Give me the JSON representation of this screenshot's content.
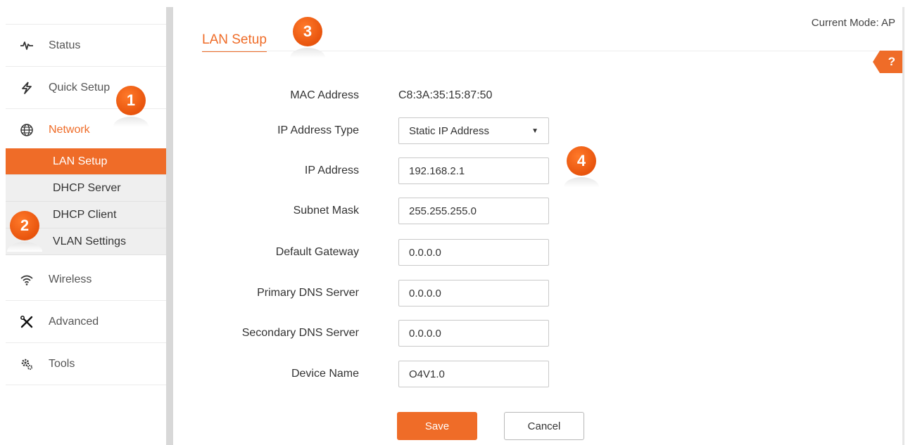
{
  "sidebar": {
    "items": [
      {
        "label": "Status",
        "icon": "pulse-icon"
      },
      {
        "label": "Quick Setup",
        "icon": "bolt-icon"
      },
      {
        "label": "Network",
        "icon": "globe-icon"
      },
      {
        "label": "Wireless",
        "icon": "wifi-icon"
      },
      {
        "label": "Advanced",
        "icon": "tools-cross-icon"
      },
      {
        "label": "Tools",
        "icon": "gears-icon"
      }
    ],
    "network_sub": [
      {
        "label": "LAN Setup"
      },
      {
        "label": "DHCP Server"
      },
      {
        "label": "DHCP Client"
      },
      {
        "label": "VLAN Settings"
      }
    ]
  },
  "header": {
    "mode": "Current Mode: AP",
    "title": "LAN Setup",
    "help": "?"
  },
  "form": {
    "mac": {
      "label": "MAC Address",
      "value": "C8:3A:35:15:87:50"
    },
    "ip_type": {
      "label": "IP Address Type",
      "value": "Static IP Address"
    },
    "ip": {
      "label": "IP Address",
      "value": "192.168.2.1"
    },
    "mask": {
      "label": "Subnet Mask",
      "value": "255.255.255.0"
    },
    "gateway": {
      "label": "Default Gateway",
      "value": "0.0.0.0"
    },
    "dns1": {
      "label": "Primary DNS Server",
      "value": "0.0.0.0"
    },
    "dns2": {
      "label": "Secondary DNS Server",
      "value": "0.0.0.0"
    },
    "device": {
      "label": "Device Name",
      "value": "O4V1.0"
    }
  },
  "buttons": {
    "save": "Save",
    "cancel": "Cancel"
  },
  "callouts": [
    "1",
    "2",
    "3",
    "4"
  ],
  "colors": {
    "accent": "#ef6c28"
  }
}
